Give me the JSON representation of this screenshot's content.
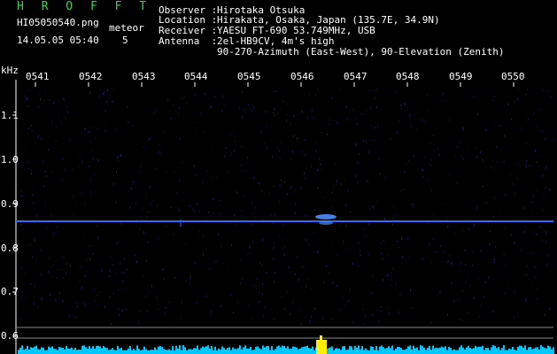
{
  "app": {
    "title": "H R O F F T"
  },
  "file": {
    "name": "HI05050540.png",
    "timestamp": "14.05.05 05:40"
  },
  "meteor": {
    "label": "meteor",
    "count": "5"
  },
  "info": {
    "observer_label": "Observer :",
    "observer": "Hirotaka Otsuka",
    "location_label": "Location :",
    "location": "Hirakata, Osaka, Japan (135.7E, 34.9N)",
    "receiver_label": "Receiver :",
    "receiver": "YAESU FT-690 53.749MHz, USB",
    "antenna_label": "Antenna  :",
    "antenna": "2el-HB9CV, 4m's high",
    "antenna_line2": "90-270-Azimuth (East-West), 90-Elevation (Zenith)"
  },
  "axis": {
    "y_unit": "kHz",
    "y_ticks": [
      "1.1",
      "1.0",
      "0.9",
      "0.8",
      "0.7",
      "0.6"
    ],
    "x_ticks": [
      "0541",
      "0542",
      "0543",
      "0544",
      "0545",
      "0546",
      "0547",
      "0548",
      "0549",
      "0550"
    ]
  },
  "colors": {
    "background": "#000000",
    "text": "#ffffff",
    "title": "#39d353",
    "carrier": "#2b6cff",
    "level": "#00c8ff",
    "level_peak": "#ffee00"
  }
}
